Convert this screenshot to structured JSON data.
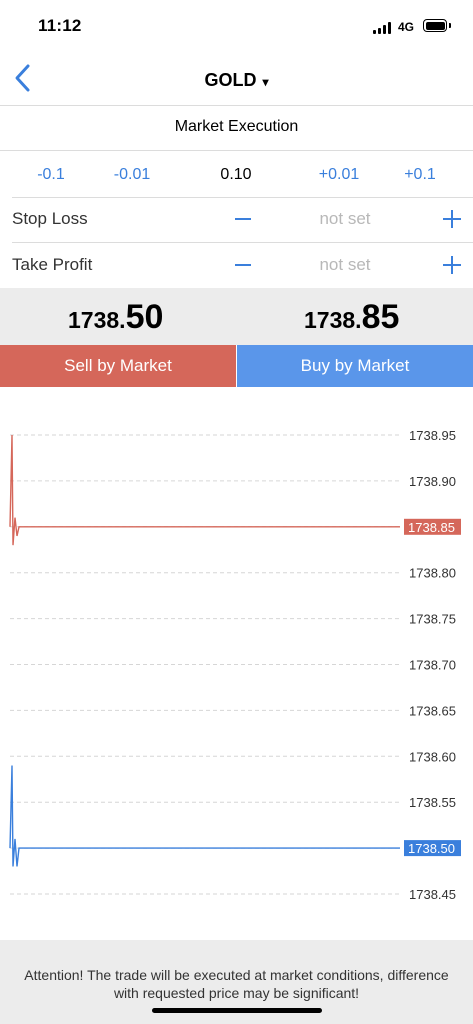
{
  "status": {
    "time": "11:12",
    "network": "4G"
  },
  "nav": {
    "title": "GOLD",
    "caret": "▾",
    "back_icon": "chevron-left-icon"
  },
  "execution": {
    "label": "Market Execution"
  },
  "volume": {
    "steps": [
      "-0.1",
      "-0.01",
      "0.10",
      "+0.01",
      "+0.1"
    ]
  },
  "stop_loss": {
    "label": "Stop Loss",
    "value": "not set"
  },
  "take_profit": {
    "label": "Take Profit",
    "value": "not set"
  },
  "prices": {
    "sell_prefix": "1738.",
    "sell_suffix": "50",
    "buy_prefix": "1738.",
    "buy_suffix": "85"
  },
  "buttons": {
    "sell": "Sell by Market",
    "buy": "Buy by Market"
  },
  "colors": {
    "sell": "#d5675a",
    "buy": "#5a96ea",
    "accent": "#3a7fdc"
  },
  "chart_data": {
    "type": "line",
    "y_ticks": [
      "1738.95",
      "1738.90",
      "1738.85",
      "1738.80",
      "1738.75",
      "1738.70",
      "1738.65",
      "1738.60",
      "1738.55",
      "1738.50",
      "1738.45"
    ],
    "ylim": [
      1738.45,
      1738.95
    ],
    "grid": true,
    "series": [
      {
        "color": "#d5675a",
        "label": "1738.85",
        "values": [
          1738.85,
          1738.95,
          1738.83,
          1738.86,
          1738.84,
          1738.85,
          1738.85
        ]
      },
      {
        "color": "#3a7fdc",
        "label": "1738.50",
        "values": [
          1738.5,
          1738.59,
          1738.48,
          1738.51,
          1738.48,
          1738.5,
          1738.5
        ]
      }
    ]
  },
  "notice": "Attention! The trade will be executed at market conditions, difference with requested price may be significant!"
}
